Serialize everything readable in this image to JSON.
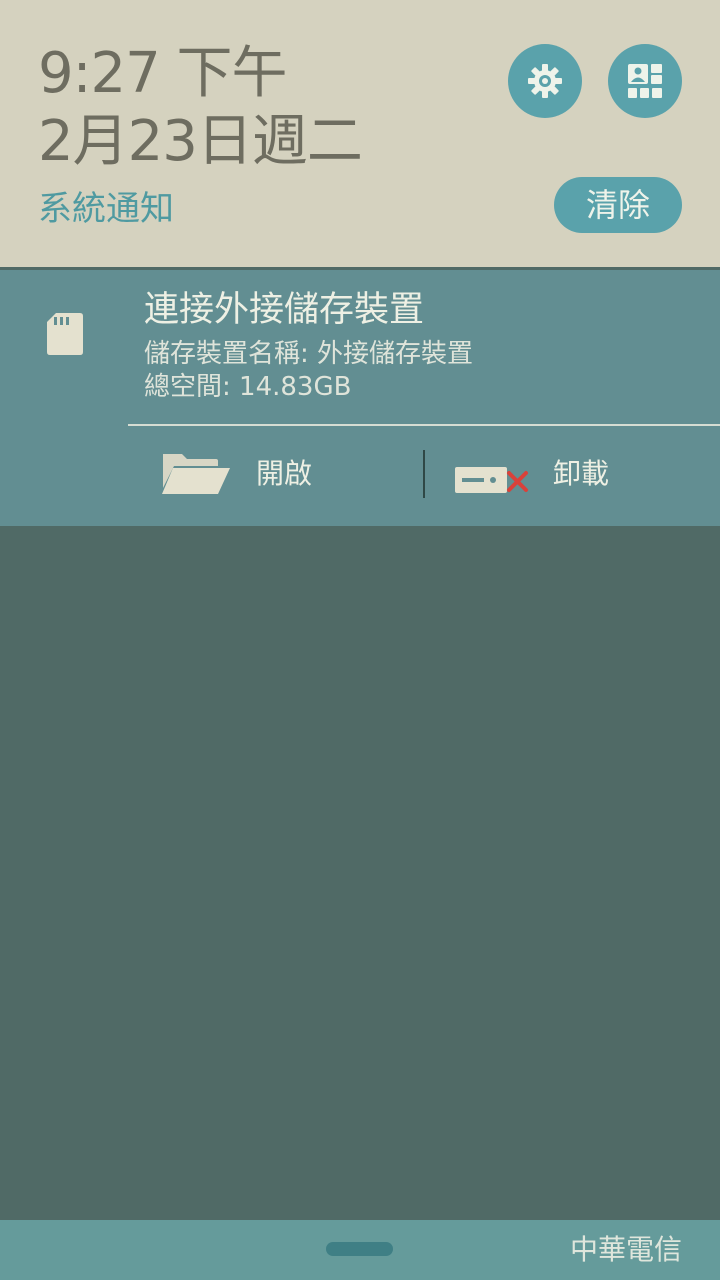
{
  "header": {
    "time": "9:27 下午",
    "date": "2月23日週二",
    "section_label": "系統通知",
    "settings_icon": "gear-icon",
    "quick_settings_icon": "quick-settings-icon",
    "clear_label": "清除"
  },
  "notification": {
    "icon": "sd-card-icon",
    "title": "連接外接儲存裝置",
    "line1": "儲存裝置名稱: 外接儲存裝置",
    "line2": "總空間: 14.83GB",
    "actions": [
      {
        "label": "開啟",
        "icon": "folder-open-icon"
      },
      {
        "label": "卸載",
        "icon": "eject-drive-icon"
      }
    ]
  },
  "status_bar": {
    "carrier": "中華電信"
  },
  "colors": {
    "header_bg": "#d5d2bf",
    "accent": "#5aa2ab",
    "notification_bg": "#628e92",
    "shade_bg": "#506a66",
    "bottom_bar": "#659b9b"
  }
}
